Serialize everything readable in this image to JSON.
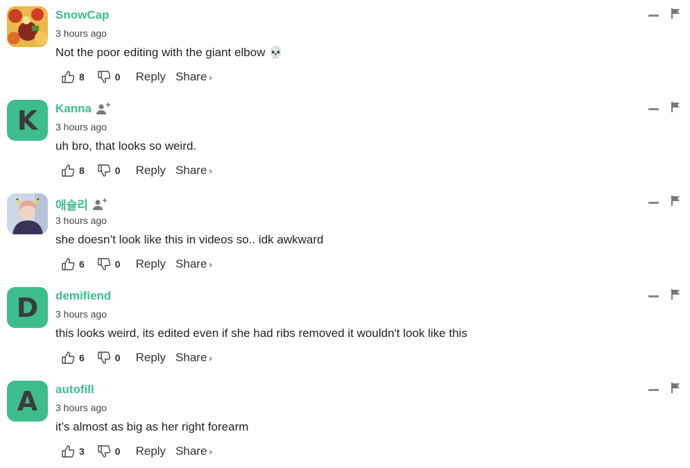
{
  "actions": {
    "reply_label": "Reply",
    "share_label": "Share",
    "share_chevron": "›"
  },
  "colors": {
    "accent": "#3dbd8e",
    "icon_gray": "#888888"
  },
  "comments": [
    {
      "username": "SnowCap",
      "time": "3 hours ago",
      "text": "Not the poor editing with the giant elbow",
      "emoji": "💀",
      "likes": "8",
      "dislikes": "0",
      "avatar": "image",
      "follow_icon": false
    },
    {
      "username": "Kanna",
      "time": "3 hours ago",
      "text": "uh bro, that looks so weird.",
      "likes": "8",
      "dislikes": "0",
      "avatar": "K",
      "follow_icon": true
    },
    {
      "username": "애슐리",
      "time": "3 hours ago",
      "text": "she doesn’t look like this in videos so.. idk awkward",
      "likes": "6",
      "dislikes": "0",
      "avatar": "image",
      "follow_icon": true
    },
    {
      "username": "demifiend",
      "time": "3 hours ago",
      "text": "this looks weird, its edited even if she had ribs removed it wouldn't look like this",
      "likes": "6",
      "dislikes": "0",
      "avatar": "D",
      "follow_icon": false
    },
    {
      "username": "autofill",
      "time": "3 hours ago",
      "text": "it’s almost as big as her right forearm",
      "likes": "3",
      "dislikes": "0",
      "avatar": "A",
      "follow_icon": false
    }
  ]
}
